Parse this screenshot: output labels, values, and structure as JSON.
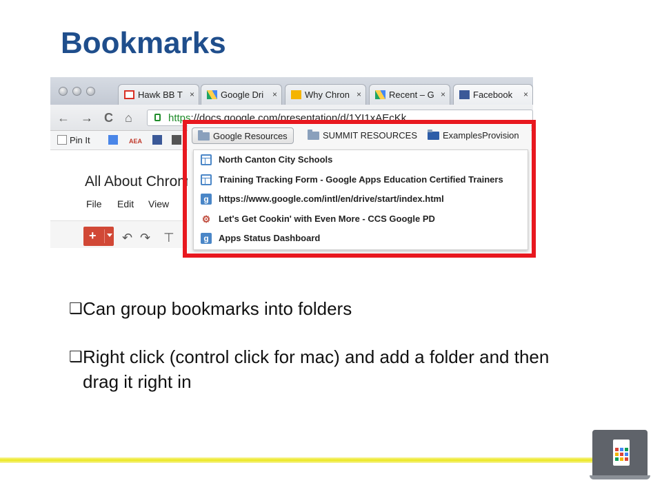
{
  "slide": {
    "title": "Bookmarks",
    "bullets": [
      "Can group bookmarks into folders",
      "Right click (control click for mac) and add a folder and then drag it right in"
    ],
    "bullet_marker": "❑"
  },
  "browser": {
    "tabs": [
      {
        "label": "Hawk BB T",
        "icon": "gmail-icon"
      },
      {
        "label": "Google Dri",
        "icon": "google-drive-icon"
      },
      {
        "label": "Why Chron",
        "icon": "slides-icon"
      },
      {
        "label": "Recent – G",
        "icon": "google-drive-icon"
      },
      {
        "label": "Facebook",
        "icon": "facebook-icon"
      }
    ],
    "tab_close": "×",
    "url_scheme": "https",
    "url_rest": "://docs.google.com/presentation/d/1YI1xAEcKk",
    "nav": {
      "back": "←",
      "forward": "→",
      "reload": "C",
      "home": "⌂"
    },
    "bookmarks_bar": [
      {
        "label": "Pin It",
        "icon": "page-icon"
      },
      {
        "label": "",
        "icon": "docs-icon"
      },
      {
        "label": "AEA",
        "icon": "aea-icon"
      },
      {
        "label": "",
        "icon": "facebook-icon"
      }
    ],
    "doc_title": "All About Chrom",
    "doc_menu": [
      "File",
      "Edit",
      "View"
    ],
    "plus_label": "+"
  },
  "dropdown": {
    "folders": [
      {
        "label": "Google Resources",
        "active": true
      },
      {
        "label": "SUMMIT RESOURCES",
        "active": false
      },
      {
        "label": "ExamplesProvision",
        "active": false
      }
    ],
    "items": [
      {
        "label": "North Canton City Schools",
        "icon": "sheet-icon"
      },
      {
        "label": "Training Tracking Form - Google Apps Education Certified Trainers",
        "icon": "sheet-icon"
      },
      {
        "label": "https://www.google.com/intl/en/drive/start/index.html",
        "icon": "google-icon"
      },
      {
        "label": "Let's Get Cookin' with Even More - CCS Google PD",
        "icon": "sites-icon"
      },
      {
        "label": "Apps Status Dashboard",
        "icon": "google-icon"
      }
    ]
  },
  "colors": {
    "title": "#1f4e8c",
    "highlight_box": "#e8181f",
    "footer_line": "#ece81e",
    "new_button": "#d14836"
  }
}
